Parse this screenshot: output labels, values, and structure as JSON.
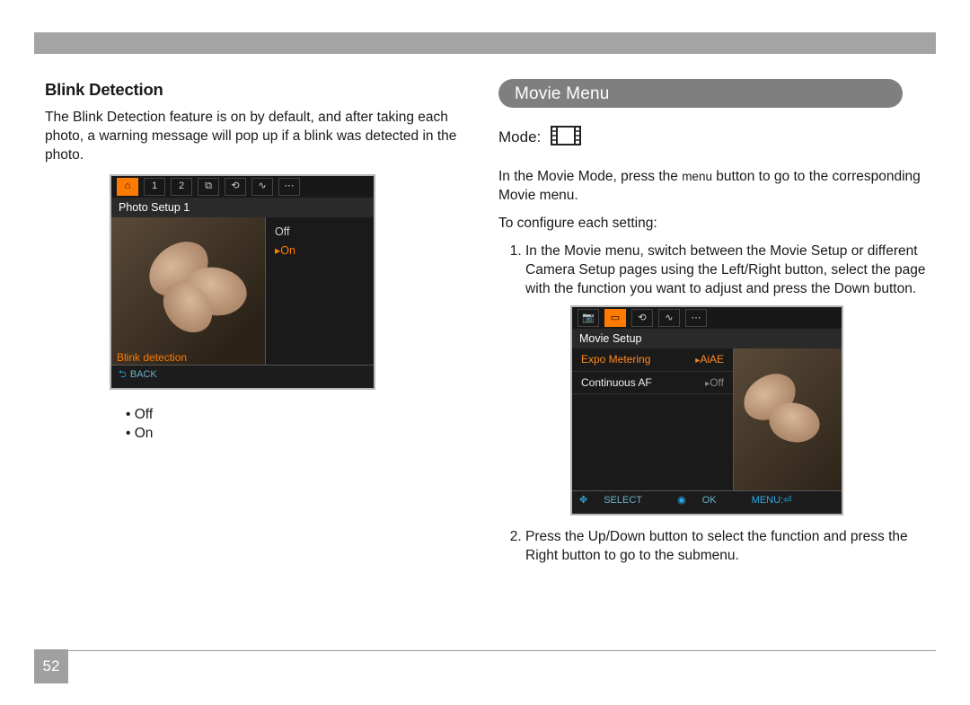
{
  "page_number": "52",
  "left": {
    "heading": "Blink Detection",
    "paragraph": "The Blink Detection feature is on by default, and after taking each photo, a warning message will pop up if a blink was detected in the photo.",
    "options": [
      "Off",
      "On"
    ],
    "lcd": {
      "tabs": [
        "⌂",
        "1",
        "2",
        "⧉",
        "⟲",
        "∿",
        "⋯"
      ],
      "title": "Photo Setup 1",
      "menu_off": "Off",
      "menu_on": "On",
      "current_label": "Blink detection",
      "footer_back": "BACK"
    }
  },
  "right": {
    "pill": "Movie Menu",
    "mode_label": "Mode:",
    "para1_a": "In the Movie Mode, press the ",
    "para1_menu": "menu",
    "para1_b": " button to go to the corresponding Movie menu.",
    "configure": "To configure each setting:",
    "step1": "In the Movie menu, switch between the Movie Setup or different Camera Setup pages using the Left/Right button, select the page with the function you want to adjust and press the Down button.",
    "step2": "Press the Up/Down button to select the function and press the Right button to go to the submenu.",
    "lcd": {
      "tabs": [
        "📷",
        "▭",
        "⟲",
        "∿",
        "⋯"
      ],
      "title": "Movie Setup",
      "row1_label": "Expo Metering",
      "row1_value": "AiAE",
      "row2_label": "Continuous AF",
      "row2_value": "Off",
      "foot_select": "SELECT",
      "foot_ok": "OK",
      "foot_menu": "MENU:⏎"
    }
  }
}
